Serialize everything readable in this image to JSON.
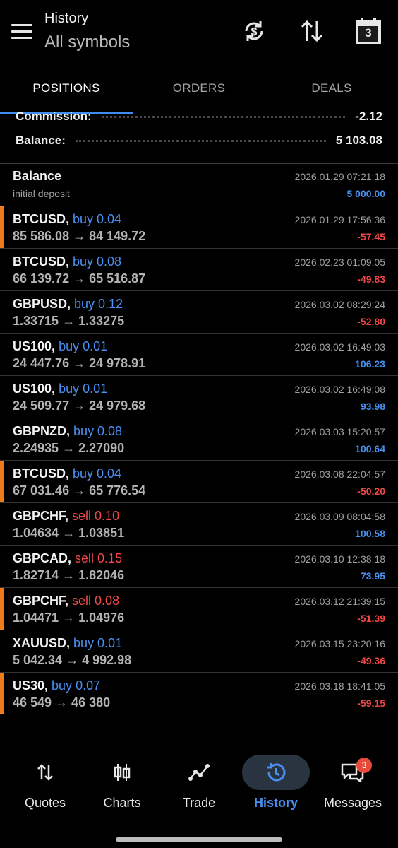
{
  "header": {
    "title": "History",
    "subtitle": "All symbols",
    "calendar_day": "3",
    "icons": [
      "menu-icon",
      "currency-exchange-icon",
      "sort-icon",
      "calendar-icon"
    ]
  },
  "tabs": [
    {
      "label": "POSITIONS",
      "active": true
    },
    {
      "label": "ORDERS",
      "active": false
    },
    {
      "label": "DEALS",
      "active": false
    }
  ],
  "summary": {
    "commission_label": "Commission:",
    "commission_value": "-2.12",
    "balance_label": "Balance:",
    "balance_value": "5 103.08"
  },
  "balance_entry": {
    "title": "Balance",
    "description": "initial deposit",
    "time": "2026.01.29 07:21:18",
    "amount": "5 000.00"
  },
  "positions": [
    {
      "symbol": "BTCUSD,",
      "direction": "buy",
      "volume": "buy 0.04",
      "prices": "85 586.08 → 84 149.72",
      "time": "2026.01.29 17:56:36",
      "profit": "-57.45",
      "loss_marker": true
    },
    {
      "symbol": "BTCUSD,",
      "direction": "buy",
      "volume": "buy 0.08",
      "prices": "66 139.72 → 65 516.87",
      "time": "2026.02.23 01:09:05",
      "profit": "-49.83",
      "loss_marker": false
    },
    {
      "symbol": "GBPUSD,",
      "direction": "buy",
      "volume": "buy 0.12",
      "prices": "1.33715 → 1.33275",
      "time": "2026.03.02 08:29:24",
      "profit": "-52.80",
      "loss_marker": false
    },
    {
      "symbol": "US100,",
      "direction": "buy",
      "volume": "buy 0.01",
      "prices": "24 447.76 → 24 978.91",
      "time": "2026.03.02 16:49:03",
      "profit": "106.23",
      "loss_marker": false
    },
    {
      "symbol": "US100,",
      "direction": "buy",
      "volume": "buy 0.01",
      "prices": "24 509.77 → 24 979.68",
      "time": "2026.03.02 16:49:08",
      "profit": "93.98",
      "loss_marker": false
    },
    {
      "symbol": "GBPNZD,",
      "direction": "buy",
      "volume": "buy 0.08",
      "prices": "2.24935 → 2.27090",
      "time": "2026.03.03 15:20:57",
      "profit": "100.64",
      "loss_marker": false
    },
    {
      "symbol": "BTCUSD,",
      "direction": "buy",
      "volume": "buy 0.04",
      "prices": "67 031.46 → 65 776.54",
      "time": "2026.03.08 22:04:57",
      "profit": "-50.20",
      "loss_marker": true
    },
    {
      "symbol": "GBPCHF,",
      "direction": "sell",
      "volume": "sell 0.10",
      "prices": "1.04634 → 1.03851",
      "time": "2026.03.09 08:04:58",
      "profit": "100.58",
      "loss_marker": false
    },
    {
      "symbol": "GBPCAD,",
      "direction": "sell",
      "volume": "sell 0.15",
      "prices": "1.82714 → 1.82046",
      "time": "2026.03.10 12:38:18",
      "profit": "73.95",
      "loss_marker": false
    },
    {
      "symbol": "GBPCHF,",
      "direction": "sell",
      "volume": "sell 0.08",
      "prices": "1.04471 → 1.04976",
      "time": "2026.03.12 21:39:15",
      "profit": "-51.39",
      "loss_marker": true
    },
    {
      "symbol": "XAUUSD,",
      "direction": "buy",
      "volume": "buy 0.01",
      "prices": "5 042.34 → 4 992.98",
      "time": "2026.03.15 23:20:16",
      "profit": "-49.36",
      "loss_marker": false
    },
    {
      "symbol": "US30,",
      "direction": "buy",
      "volume": "buy 0.07",
      "prices": "46 549 → 46 380",
      "time": "2026.03.18 18:41:05",
      "profit": "-59.15",
      "loss_marker": true
    }
  ],
  "nav": [
    {
      "label": "Quotes",
      "icon": "quotes-icon",
      "active": false
    },
    {
      "label": "Charts",
      "icon": "charts-icon",
      "active": false
    },
    {
      "label": "Trade",
      "icon": "trade-icon",
      "active": false
    },
    {
      "label": "History",
      "icon": "history-icon",
      "active": true
    },
    {
      "label": "Messages",
      "icon": "messages-icon",
      "active": false,
      "badge": "3"
    }
  ],
  "colors": {
    "accent": "#4a90f2",
    "loss": "#f04848",
    "marker": "#ef7a1a",
    "background": "#000000"
  }
}
